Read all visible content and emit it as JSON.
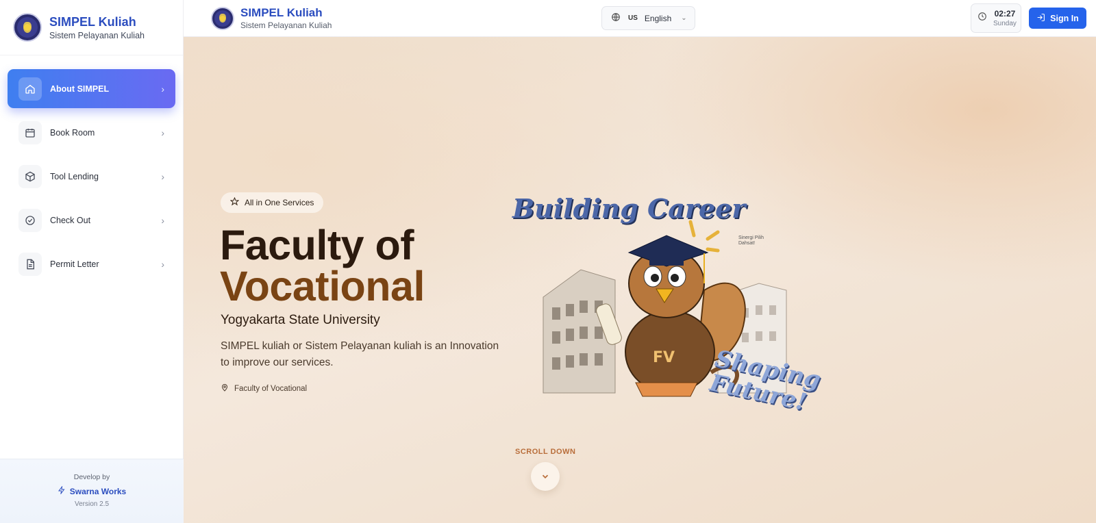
{
  "sidebar": {
    "brand_title": "SIMPEL Kuliah",
    "brand_subtitle": "Sistem Pelayanan Kuliah",
    "items": [
      {
        "label": "About SIMPEL",
        "icon": "home-icon",
        "active": true
      },
      {
        "label": "Book Room",
        "icon": "calendar-icon",
        "active": false
      },
      {
        "label": "Tool Lending",
        "icon": "box-icon",
        "active": false
      },
      {
        "label": "Check Out",
        "icon": "check-circle-icon",
        "active": false
      },
      {
        "label": "Permit Letter",
        "icon": "document-icon",
        "active": false
      }
    ],
    "footer": {
      "develop_by": "Develop by",
      "developer": "Swarna Works",
      "version": "Version 2.5"
    }
  },
  "header": {
    "title": "SIMPEL Kuliah",
    "subtitle": "Sistem Pelayanan Kuliah",
    "language": {
      "flag": "US",
      "label": "English"
    },
    "clock": {
      "time": "02:27",
      "day": "Sunday"
    },
    "signin_label": "Sign In"
  },
  "hero": {
    "badge": "All in One Services",
    "title_line1": "Faculty of",
    "title_line2": "Vocational",
    "university": "Yogyakarta State University",
    "description": "SIMPEL kuliah or Sistem Pelayanan kuliah is an Innovation to improve our services.",
    "location": "Faculty of Vocational",
    "illustration": {
      "text_top": "Building Career",
      "text_bottom": "Shaping Future!",
      "mini_logo_text": "Sinergi Pilih Dahsat!"
    },
    "scroll_label": "SCROLL DOWN"
  },
  "colors": {
    "brand_blue": "#2b4dbf",
    "signin_blue": "#2563eb",
    "title_dark": "#2b1a0e",
    "title_brown": "#7a4414",
    "accent_orange": "#b86d3a"
  }
}
